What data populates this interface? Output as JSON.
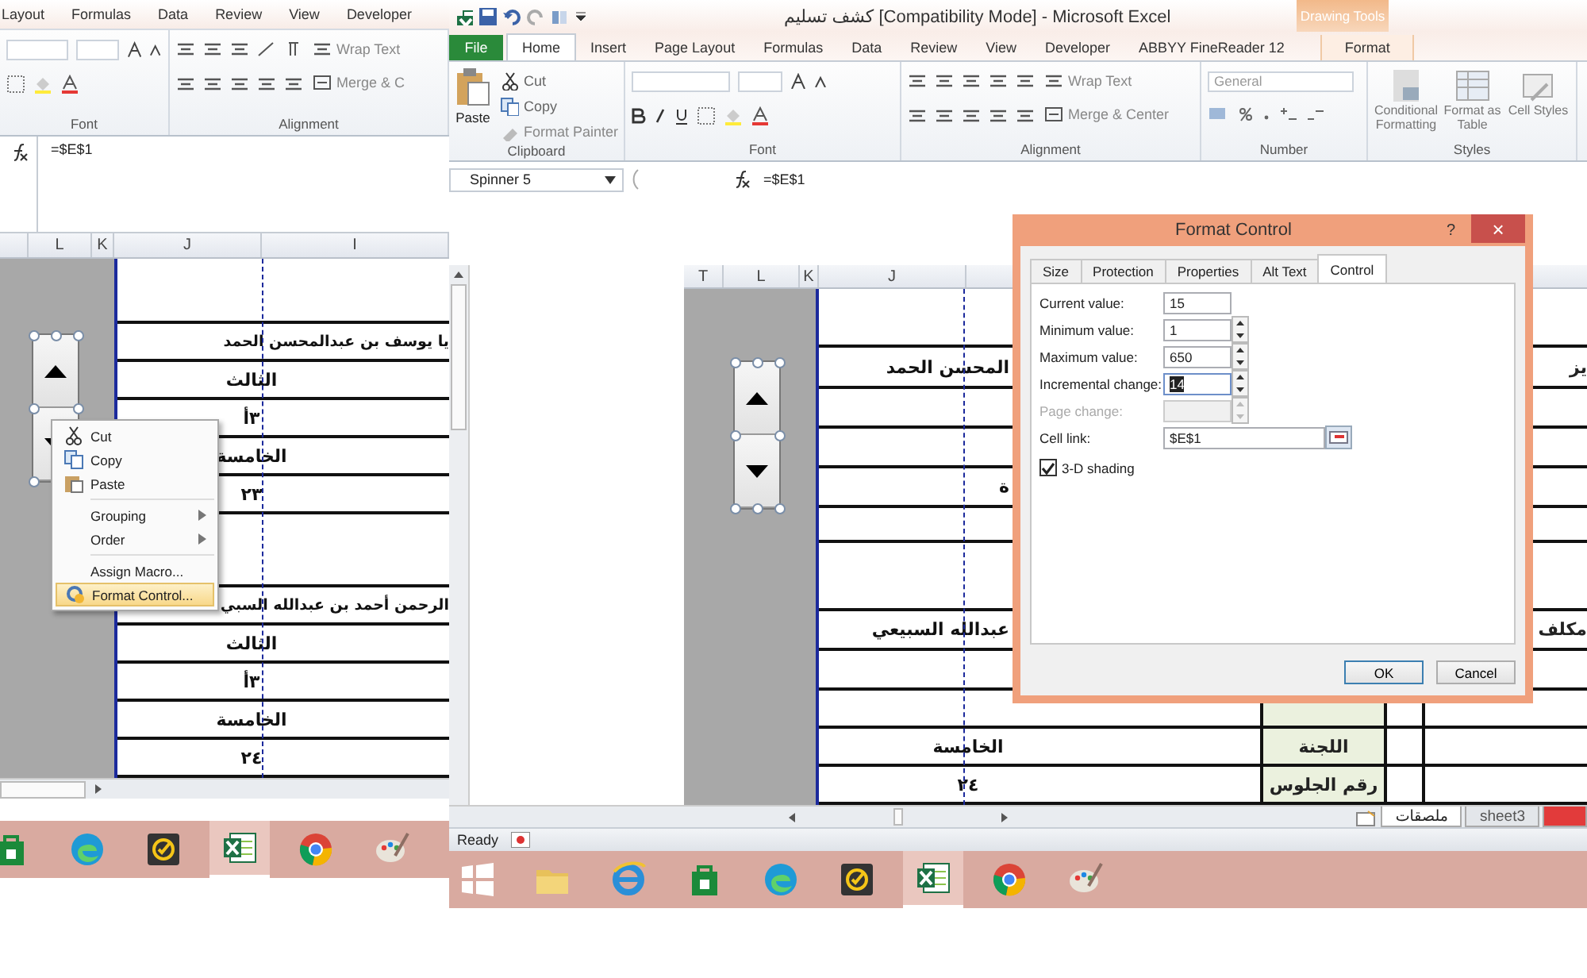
{
  "left_window": {
    "ribbon_tabs": [
      "Layout",
      "Formulas",
      "Data",
      "Review",
      "View",
      "Developer"
    ],
    "wrap_text": "Wrap Text",
    "merge_center": "Merge & C",
    "groups": [
      "Font",
      "Alignment"
    ],
    "formula": "=$E$1",
    "columns": [
      "L",
      "K",
      "J",
      "I"
    ],
    "rows": [
      {
        "kind": "blank"
      },
      {
        "kind": "name",
        "text": "يا يوسف بن عبدالمحسن الحمد"
      },
      {
        "kind": "value",
        "text": "الثالث"
      },
      {
        "kind": "value",
        "text": "٣أ"
      },
      {
        "kind": "value",
        "text": "الخامسة"
      },
      {
        "kind": "value",
        "text": "٢٣"
      },
      {
        "kind": "blank"
      },
      {
        "kind": "name",
        "text": "الرحمن أحمد بن عبدالله السبي"
      },
      {
        "kind": "value",
        "text": "الثالث"
      },
      {
        "kind": "value",
        "text": "٣أ"
      },
      {
        "kind": "value",
        "text": "الخامسة"
      },
      {
        "kind": "value",
        "text": "٢٤"
      }
    ],
    "context_menu": [
      [
        {
          "kind": "cut",
          "label": "Cut",
          "selected": false
        },
        {
          "kind": "copy",
          "label": "Copy",
          "selected": false
        },
        {
          "kind": "paste",
          "label": "Paste",
          "selected": false
        }
      ],
      [
        {
          "kind": "submenu",
          "label": "Grouping",
          "selected": false
        },
        {
          "kind": "submenu",
          "label": "Order",
          "selected": false
        }
      ],
      [
        {
          "kind": "plain",
          "label": "Assign Macro...",
          "selected": false
        },
        {
          "kind": "format",
          "label": "Format Control...",
          "selected": true
        }
      ]
    ],
    "taskbar": [
      {
        "kind": "store",
        "selected": false
      },
      {
        "kind": "edge",
        "selected": false
      },
      {
        "kind": "tasks",
        "selected": false
      },
      {
        "kind": "excel",
        "selected": true
      },
      {
        "kind": "chrome",
        "selected": false
      },
      {
        "kind": "paint",
        "selected": false
      }
    ]
  },
  "right_window": {
    "title": "كشف تسليم [Compatibility Mode] - Microsoft Excel",
    "context_tab": "Drawing Tools",
    "tabs": [
      {
        "label": "File",
        "kind": "file",
        "selected": false
      },
      {
        "label": "Home",
        "kind": "tab",
        "selected": true
      },
      {
        "label": "Insert",
        "kind": "tab",
        "selected": false
      },
      {
        "label": "Page Layout",
        "kind": "tab",
        "selected": false
      },
      {
        "label": "Formulas",
        "kind": "tab",
        "selected": false
      },
      {
        "label": "Data",
        "kind": "tab",
        "selected": false
      },
      {
        "label": "Review",
        "kind": "tab",
        "selected": false
      },
      {
        "label": "View",
        "kind": "tab",
        "selected": false
      },
      {
        "label": "Developer",
        "kind": "tab",
        "selected": false
      },
      {
        "label": "ABBYY FineReader 12",
        "kind": "tab",
        "selected": false
      },
      {
        "label": "Format",
        "kind": "context",
        "selected": false
      }
    ],
    "clipboard": {
      "paste": "Paste",
      "cut": "Cut",
      "copy": "Copy",
      "format_painter": "Format Painter"
    },
    "wrap_text": "Wrap Text",
    "merge_center": "Merge & Center",
    "number_format": "General",
    "styles": [
      "Conditional Formatting",
      "Format as Table",
      "Cell Styles"
    ],
    "groups": [
      "Clipboard",
      "Font",
      "Alignment",
      "Number",
      "Styles"
    ],
    "name_box": "Spinner 5",
    "formula": "=$E$1",
    "columns": [
      "T",
      "L",
      "K",
      "J"
    ],
    "rows": [
      {
        "kind": "blank"
      },
      {
        "kind": "name",
        "text": "المحسن الحمد",
        "far": "يز"
      },
      {
        "kind": "blank"
      },
      {
        "kind": "blank"
      },
      {
        "kind": "name",
        "text": "ة"
      },
      {
        "kind": "blank"
      },
      {
        "kind": "blank"
      },
      {
        "kind": "name",
        "text": "عبدالله السبيعي",
        "far": "مكلف"
      },
      {
        "kind": "blank"
      },
      {
        "kind": "blank",
        "shaded": true
      },
      {
        "kind": "value",
        "text": "الخامسة",
        "label": "اللجنة",
        "shaded": true
      },
      {
        "kind": "value",
        "text": "٢٤",
        "label": "رقم الجلوس",
        "shaded": true
      }
    ],
    "sheet_tabs": [
      {
        "label": "ملصقات",
        "selected": true
      },
      {
        "label": "sheet3",
        "selected": false
      }
    ],
    "status": "Ready",
    "taskbar": [
      {
        "kind": "start",
        "selected": false
      },
      {
        "kind": "explorer",
        "selected": false
      },
      {
        "kind": "ie",
        "selected": false
      },
      {
        "kind": "store",
        "selected": false
      },
      {
        "kind": "edge",
        "selected": false
      },
      {
        "kind": "tasks",
        "selected": false
      },
      {
        "kind": "excel",
        "selected": true
      },
      {
        "kind": "chrome",
        "selected": false
      },
      {
        "kind": "paint",
        "selected": false
      }
    ]
  },
  "dialog": {
    "title": "Format Control",
    "help": "?",
    "close": "×",
    "tabs": [
      {
        "label": "Size",
        "selected": false
      },
      {
        "label": "Protection",
        "selected": false
      },
      {
        "label": "Properties",
        "selected": false
      },
      {
        "label": "Alt Text",
        "selected": false
      },
      {
        "label": "Control",
        "selected": true
      }
    ],
    "fields": [
      {
        "label": "Current value:",
        "value": "15",
        "kind": "plain",
        "disabled": false,
        "highlighted": false
      },
      {
        "label": "Minimum value:",
        "value": "1",
        "kind": "spin",
        "disabled": false,
        "highlighted": false
      },
      {
        "label": "Maximum value:",
        "value": "650",
        "kind": "spin",
        "disabled": false,
        "highlighted": false
      },
      {
        "label": "Incremental change:",
        "value": "14",
        "kind": "spin",
        "disabled": false,
        "highlighted": true
      },
      {
        "label": "Page change:",
        "kind": "spin",
        "disabled": true,
        "highlighted": false
      },
      {
        "label": "Cell link:",
        "value": "$E$1",
        "kind": "ref",
        "disabled": false,
        "highlighted": false
      }
    ],
    "shading": {
      "label": "3-D shading",
      "checked": true
    },
    "buttons": [
      "OK",
      "Cancel"
    ]
  }
}
